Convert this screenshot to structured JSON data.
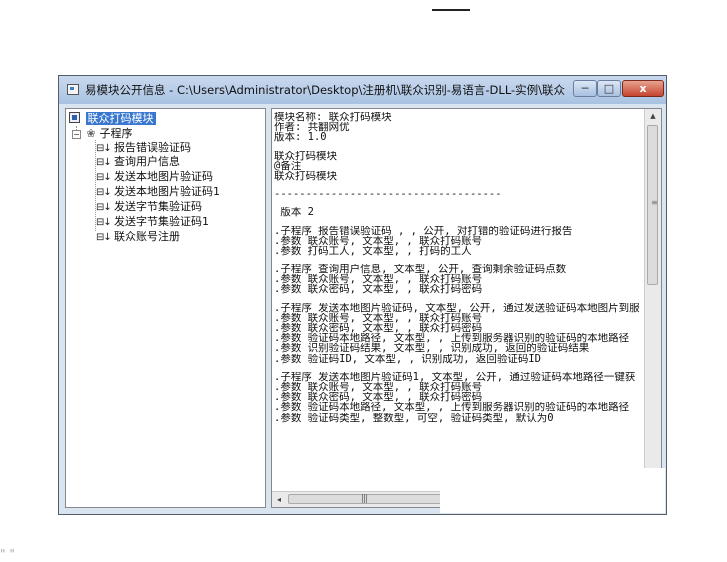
{
  "window": {
    "title": "易模块公开信息 - C:\\Users\\Administrator\\Desktop\\注册机\\联众识别-易语言-DLL-实例\\联众识...",
    "controls": {
      "minimize": "─",
      "maximize": "□",
      "close": "x"
    }
  },
  "tree": {
    "root": "联众打码模块",
    "folder": "子程序",
    "items": [
      "报告错误验证码",
      "查询用户信息",
      "发送本地图片验证码",
      "发送本地图片验证码1",
      "发送字节集验证码",
      "发送字节集验证码1",
      "联众账号注册"
    ],
    "leaf_marker": "⊟↓"
  },
  "content": {
    "lines": [
      "模块名称: 联众打码模块",
      "作者: 共翻网优",
      "版本: 1.0",
      "",
      "联众打码模块",
      "@备注",
      "联众打码模块",
      "",
      "------------------------------------",
      "",
      " 版本 2",
      "",
      ".子程序 报告错误验证码 , , 公开, 对打错的验证码进行报告",
      ".参数 联众账号, 文本型, , 联众打码账号",
      ".参数 打码工人, 文本型, , 打码的工人",
      "",
      ".子程序 查询用户信息, 文本型, 公开, 查询剩余验证码点数",
      ".参数 联众账号, 文本型, , 联众打码账号",
      ".参数 联众密码, 文本型, , 联众打码密码",
      "",
      ".子程序 发送本地图片验证码, 文本型, 公开, 通过发送验证码本地图片到服",
      ".参数 联众账号, 文本型, , 联众打码账号",
      ".参数 联众密码, 文本型, , 联众打码密码",
      ".参数 验证码本地路径, 文本型, , 上传到服务器识别的验证码的本地路径",
      ".参数 识别验证码结果, 文本型, , 识别成功, 返回的验证码结果",
      ".参数 验证码ID, 文本型, , 识别成功, 返回验证码ID",
      "",
      ".子程序 发送本地图片验证码1, 文本型, 公开, 通过验证码本地路径一键获",
      ".参数 联众账号, 文本型, , 联众打码账号",
      ".参数 联众密码, 文本型, , 联众打码密码",
      ".参数 验证码本地路径, 文本型, , 上传到服务器识别的验证码的本地路径",
      ".参数 验证码类型, 整数型, 可空, 验证码类型, 默认为0"
    ]
  },
  "scroll": {
    "h_grip": "|||",
    "v_grip": "≡"
  },
  "bottom_text": "            \"                    \"          "
}
